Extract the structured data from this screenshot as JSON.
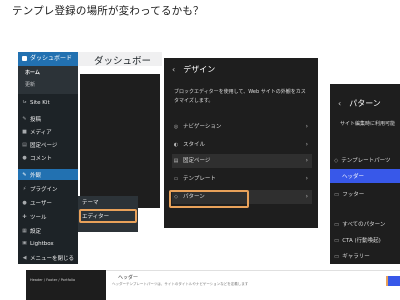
{
  "heading": "テンプレ登録の場所が変わってるかも？",
  "wp_admin": {
    "menu": [
      {
        "label": "ダッシュボード",
        "icon": "dashboard-icon"
      },
      {
        "label": "ホーム"
      },
      {
        "label": "更新"
      },
      {
        "label": "Site Kit",
        "icon": "sitekit-icon"
      },
      {
        "label": "投稿",
        "icon": "pin-icon"
      },
      {
        "label": "メディア",
        "icon": "media-icon"
      },
      {
        "label": "固定ページ",
        "icon": "page-icon"
      },
      {
        "label": "コメント",
        "icon": "comment-icon"
      },
      {
        "label": "外観",
        "icon": "appearance-icon"
      },
      {
        "label": "プラグイン",
        "icon": "plugin-icon"
      },
      {
        "label": "ユーザー",
        "icon": "user-icon"
      },
      {
        "label": "ツール",
        "icon": "tool-icon"
      },
      {
        "label": "設定",
        "icon": "settings-icon"
      },
      {
        "label": "Lightbox",
        "icon": "lightbox-icon"
      },
      {
        "label": "メニューを閉じる",
        "icon": "collapse-icon"
      }
    ],
    "page_title": "ダッシュボー",
    "flyout": [
      "テーマ",
      "エディター"
    ]
  },
  "design": {
    "title": "デザイン",
    "description": "ブロックエディターを使用して、Web サイトの外観をカスタマイズします。",
    "items": [
      {
        "label": "ナビゲーション",
        "icon": "navigation-icon"
      },
      {
        "label": "スタイル",
        "icon": "style-icon"
      },
      {
        "label": "固定ページ",
        "icon": "page-icon"
      },
      {
        "label": "テンプレート",
        "icon": "template-icon"
      },
      {
        "label": "パターン",
        "icon": "pattern-icon"
      }
    ]
  },
  "patterns": {
    "title": "パターン",
    "description": "サイト編集時に利用可能",
    "items": [
      "テンプレートパーツ",
      "ヘッダー",
      "フッター",
      "すべてのパターン",
      "CTA (行動喚起)",
      "ギャラリー"
    ]
  },
  "bottom": {
    "left_text": "Header / Footer / Portfolio",
    "heading": "ヘッダー",
    "sub": "ヘッダーテンプレートパーツは、サイトのタイトルやナビゲーションなどを定義します"
  },
  "colors": {
    "wp_blue": "#2271b1",
    "accent_orange": "#e8a15a",
    "editor_blue": "#3858e9"
  }
}
